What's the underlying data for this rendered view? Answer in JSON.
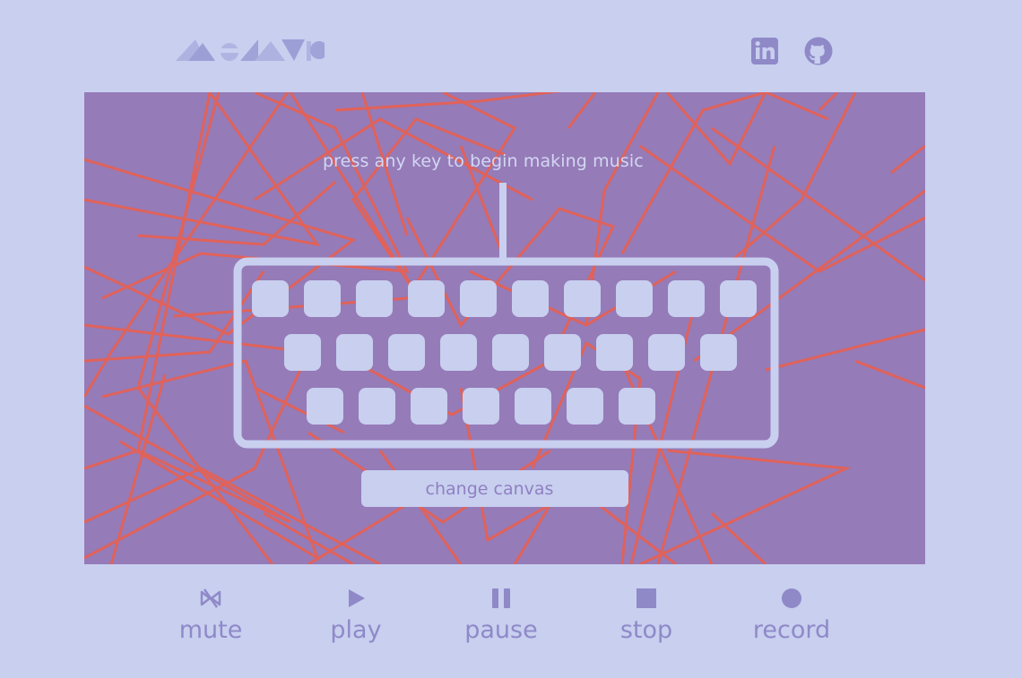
{
  "header": {
    "logo_icon": "mosaic-logo",
    "linkedin_icon": "linkedin-icon",
    "github_icon": "github-icon"
  },
  "canvas": {
    "prompt": "press any key to begin making music",
    "change_canvas_label": "change canvas",
    "background_color": "#957bb8",
    "line_color": "#e0625a"
  },
  "keyboard": {
    "rows": [
      10,
      9,
      7
    ],
    "key_color": "#c8cfef"
  },
  "controls": [
    {
      "id": "mute",
      "label": "mute",
      "icon": "mute-icon"
    },
    {
      "id": "play",
      "label": "play",
      "icon": "play-icon"
    },
    {
      "id": "pause",
      "label": "pause",
      "icon": "pause-icon"
    },
    {
      "id": "stop",
      "label": "stop",
      "icon": "stop-icon"
    },
    {
      "id": "record",
      "label": "record",
      "icon": "record-icon"
    }
  ],
  "colors": {
    "page_background": "#c8cfef",
    "accent": "#8f89c8"
  }
}
